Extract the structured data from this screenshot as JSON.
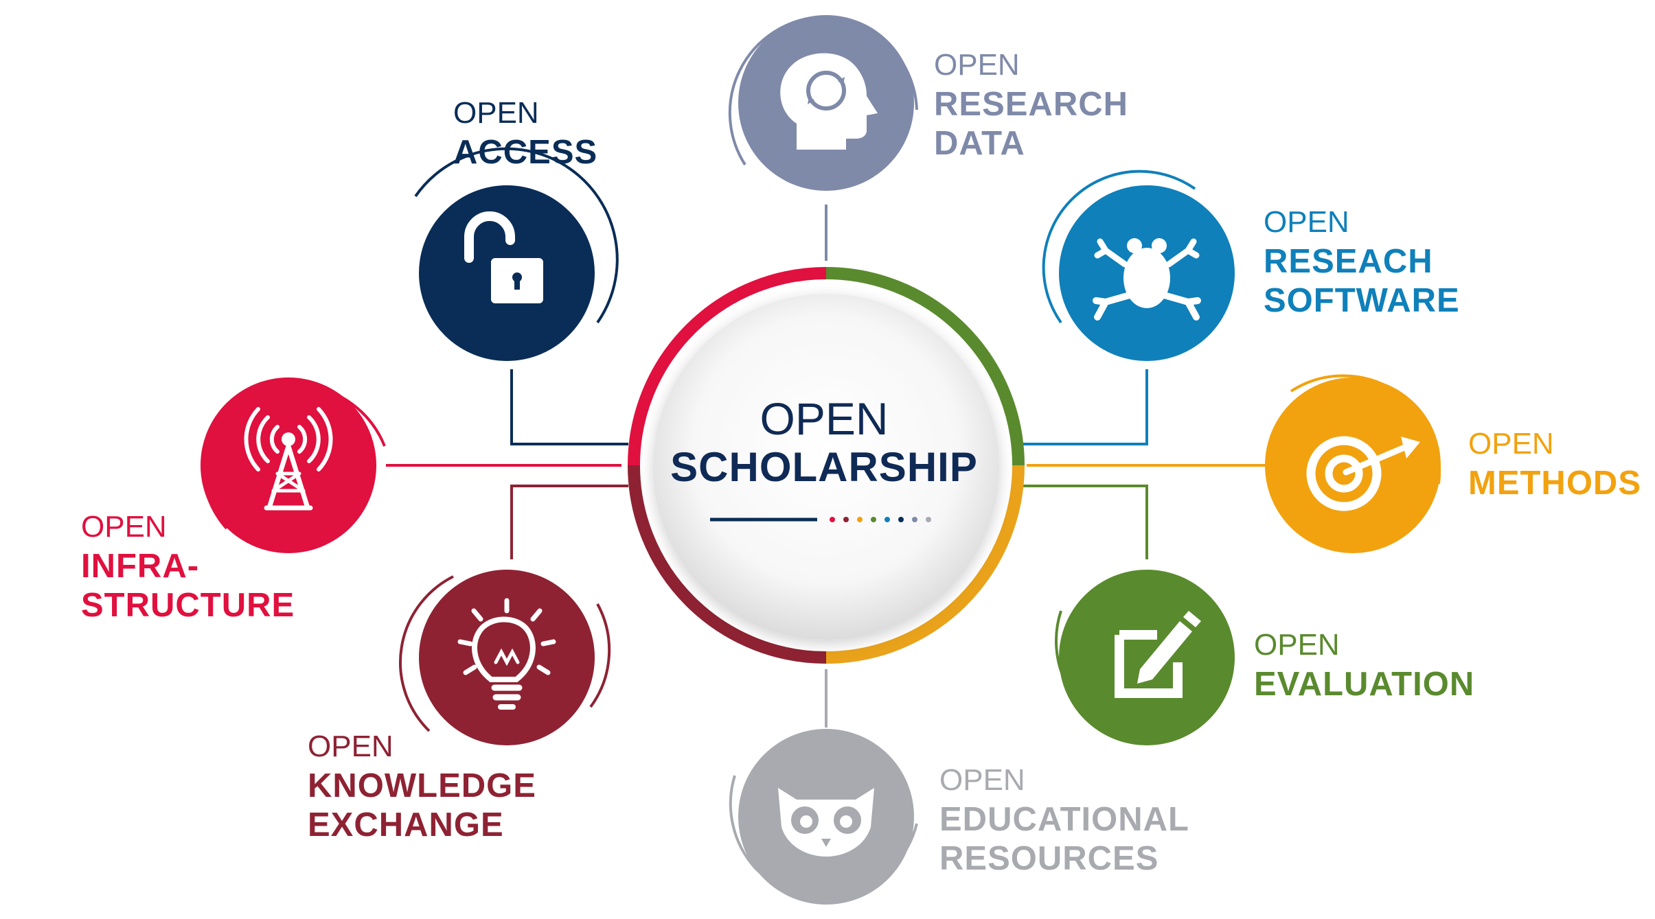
{
  "center": {
    "prefix": "OPEN",
    "title": "SCHOLARSHIP"
  },
  "colors": {
    "navy": "#0a2d57",
    "slate": "#7f8aa9",
    "blue": "#0f80ba",
    "orange": "#f2a20f",
    "green": "#5a8a2e",
    "gray": "#a8aaaf",
    "maroon": "#8e2233",
    "red": "#e0103f"
  },
  "nodes": {
    "access": {
      "prefix": "OPEN",
      "lines": [
        "ACCESS"
      ],
      "icon": "unlocked-padlock-icon",
      "color": "#0a2d57"
    },
    "data": {
      "prefix": "OPEN",
      "lines": [
        "RESEARCH",
        "DATA"
      ],
      "icon": "head-brain-cycle-icon",
      "color": "#7f8aa9"
    },
    "software": {
      "prefix": "OPEN",
      "lines": [
        "RESEACH",
        "SOFTWARE"
      ],
      "icon": "frog-icon",
      "color": "#0f80ba"
    },
    "methods": {
      "prefix": "OPEN",
      "lines": [
        "METHODS"
      ],
      "icon": "target-arrow-icon",
      "color": "#f2a20f"
    },
    "evaluation": {
      "prefix": "OPEN",
      "lines": [
        "EVALUATION"
      ],
      "icon": "edit-pencil-icon",
      "color": "#5a8a2e"
    },
    "education": {
      "prefix": "OPEN",
      "lines": [
        "EDUCATIONAL",
        "RESOURCES"
      ],
      "icon": "owl-glasses-icon",
      "color": "#a8aaaf"
    },
    "knowledge": {
      "prefix": "OPEN",
      "lines": [
        "KNOWLEDGE",
        "EXCHANGE"
      ],
      "icon": "lightbulb-icon",
      "color": "#8e2233"
    },
    "infra": {
      "prefix": "OPEN",
      "lines": [
        "INFRA-",
        "STRUCTURE"
      ],
      "icon": "radio-tower-icon",
      "color": "#e0103f"
    }
  }
}
